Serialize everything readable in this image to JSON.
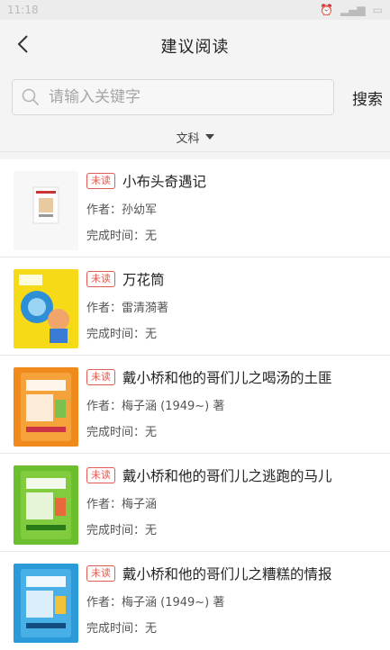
{
  "status": {
    "time": "11:18"
  },
  "header": {
    "title": "建议阅读"
  },
  "search": {
    "placeholder": "请输入关键字",
    "button_label": "搜索"
  },
  "filter": {
    "label": "文科"
  },
  "books": [
    {
      "badge": "未读",
      "title": "小布头奇遇记",
      "author": "作者：孙幼军",
      "done": "完成时间：无"
    },
    {
      "badge": "未读",
      "title": "万花筒",
      "author": "作者：雷清漪著",
      "done": "完成时间：无"
    },
    {
      "badge": "未读",
      "title": "戴小桥和他的哥们儿之喝汤的土匪",
      "author": "作者：梅子涵 (1949~) 著",
      "done": "完成时间：无"
    },
    {
      "badge": "未读",
      "title": "戴小桥和他的哥们儿之逃跑的马儿",
      "author": "作者：梅子涵",
      "done": "完成时间：无"
    },
    {
      "badge": "未读",
      "title": "戴小桥和他的哥们儿之糟糕的情报",
      "author": "作者：梅子涵 (1949~) 著",
      "done": "完成时间：无"
    }
  ]
}
